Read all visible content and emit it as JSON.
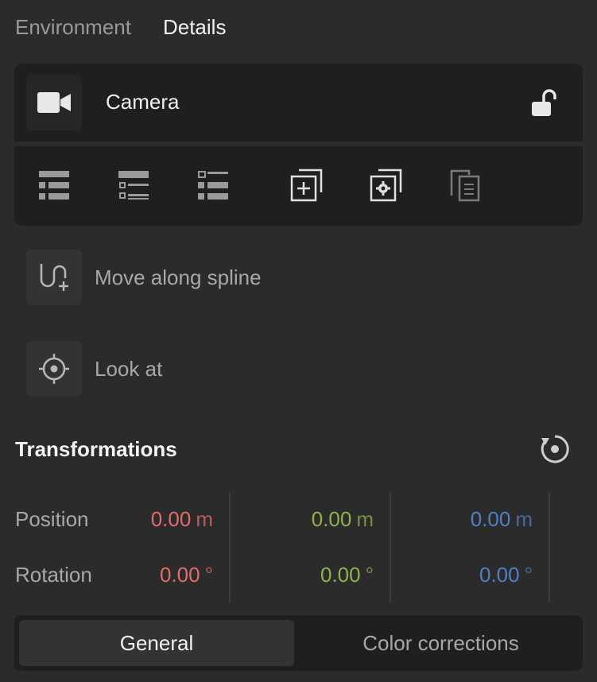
{
  "tabs": [
    {
      "label": "Environment",
      "active": false
    },
    {
      "label": "Details",
      "active": true
    }
  ],
  "object": {
    "name": "Camera",
    "icon": "camera-icon",
    "lock_icon": "unlocked-padlock-icon"
  },
  "toolbar": [
    {
      "icon": "list-collapse-all-icon"
    },
    {
      "icon": "list-expand-icon"
    },
    {
      "icon": "list-outline-icon"
    },
    {
      "icon": "duplicate-add-icon"
    },
    {
      "icon": "duplicate-settings-icon"
    },
    {
      "icon": "paste-document-icon"
    }
  ],
  "actions": [
    {
      "label": "Move along spline",
      "icon": "spline-add-icon"
    },
    {
      "label": "Look at",
      "icon": "crosshair-target-icon"
    }
  ],
  "transformations": {
    "title": "Transformations",
    "reset_icon": "reset-rotate-icon",
    "rows": [
      {
        "label": "Position",
        "values": [
          {
            "num": "0.00",
            "unit": "m"
          },
          {
            "num": "0.00",
            "unit": "m"
          },
          {
            "num": "0.00",
            "unit": "m"
          }
        ]
      },
      {
        "label": "Rotation",
        "values": [
          {
            "num": "0.00",
            "unit": "°"
          },
          {
            "num": "0.00",
            "unit": "°"
          },
          {
            "num": "0.00",
            "unit": "°"
          }
        ]
      }
    ],
    "axis_colors": [
      "#e56b6b",
      "#8eb24a",
      "#4f7fc4"
    ]
  },
  "bottom_tabs": [
    {
      "label": "General",
      "active": true
    },
    {
      "label": "Color corrections",
      "active": false
    }
  ]
}
